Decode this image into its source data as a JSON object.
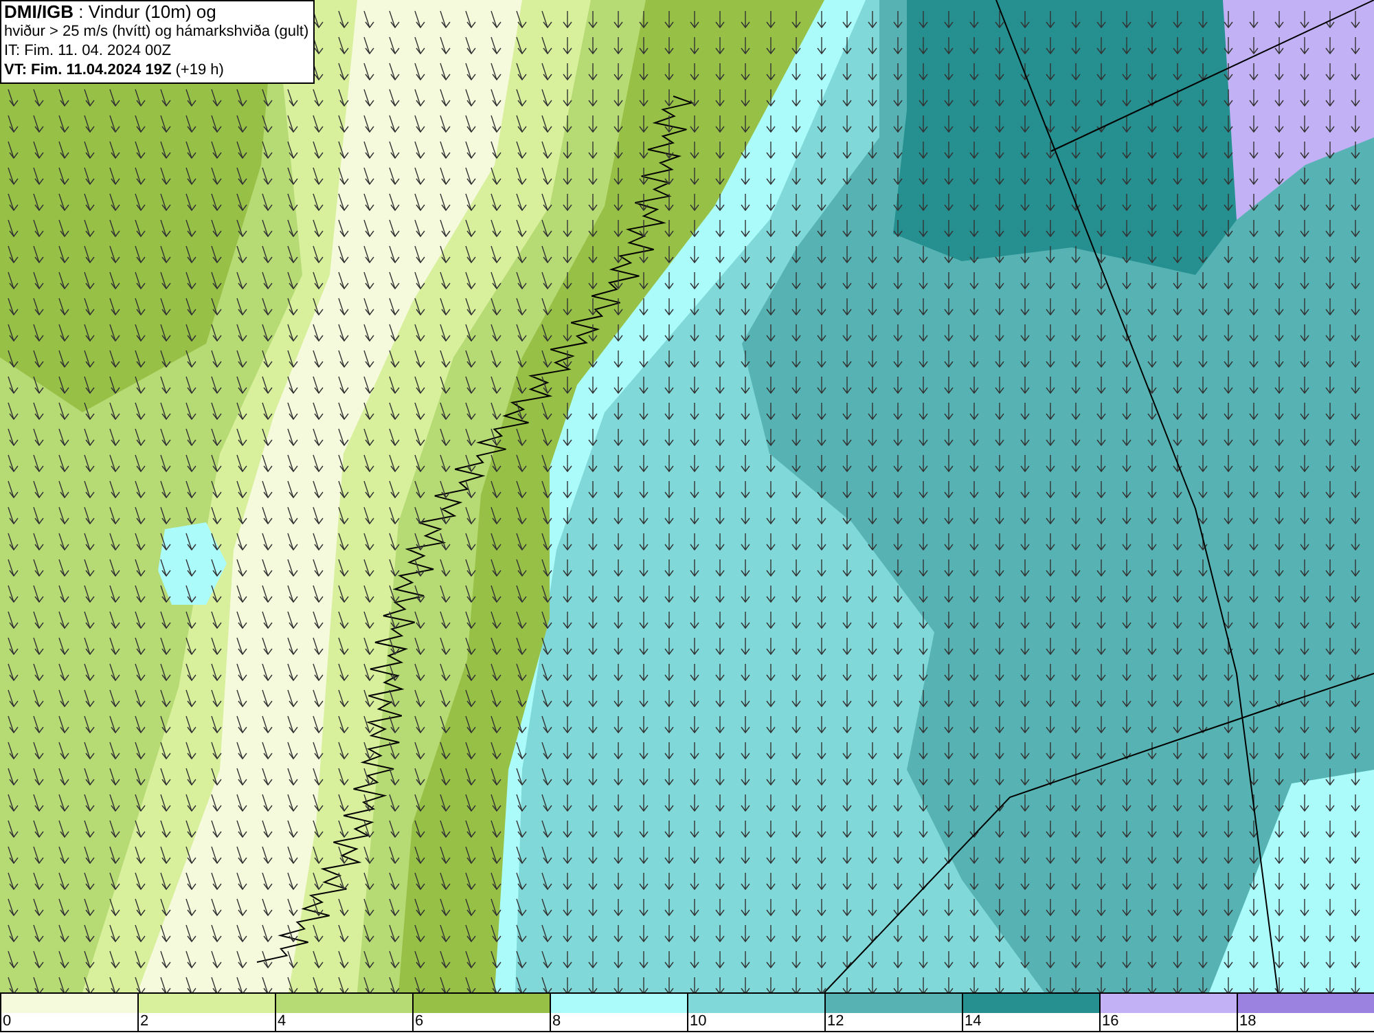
{
  "header": {
    "lines": [
      "**DMI/IGB** : Vindur (10m) og",
      "hviður > 25 m/s (hvítt) og hámarkshviða (gult)",
      "IT: Fim. 11. 04. 2024 00Z",
      "**VT: Fim. 11.04.2024 19Z** (+19 h)"
    ]
  },
  "legend": {
    "items": [
      {
        "label": "0",
        "color": "#f5fadc"
      },
      {
        "label": "2",
        "color": "#d8ef9c"
      },
      {
        "label": "4",
        "color": "#b6da74"
      },
      {
        "label": "6",
        "color": "#97c046"
      },
      {
        "label": "8",
        "color": "#acfbfb"
      },
      {
        "label": "10",
        "color": "#80d8d8"
      },
      {
        "label": "12",
        "color": "#57b3b3"
      },
      {
        "label": "14",
        "color": "#268f8f"
      },
      {
        "label": "16",
        "color": "#c2b1f5"
      },
      {
        "label": "18",
        "color": "#9c82e0"
      }
    ]
  }
}
